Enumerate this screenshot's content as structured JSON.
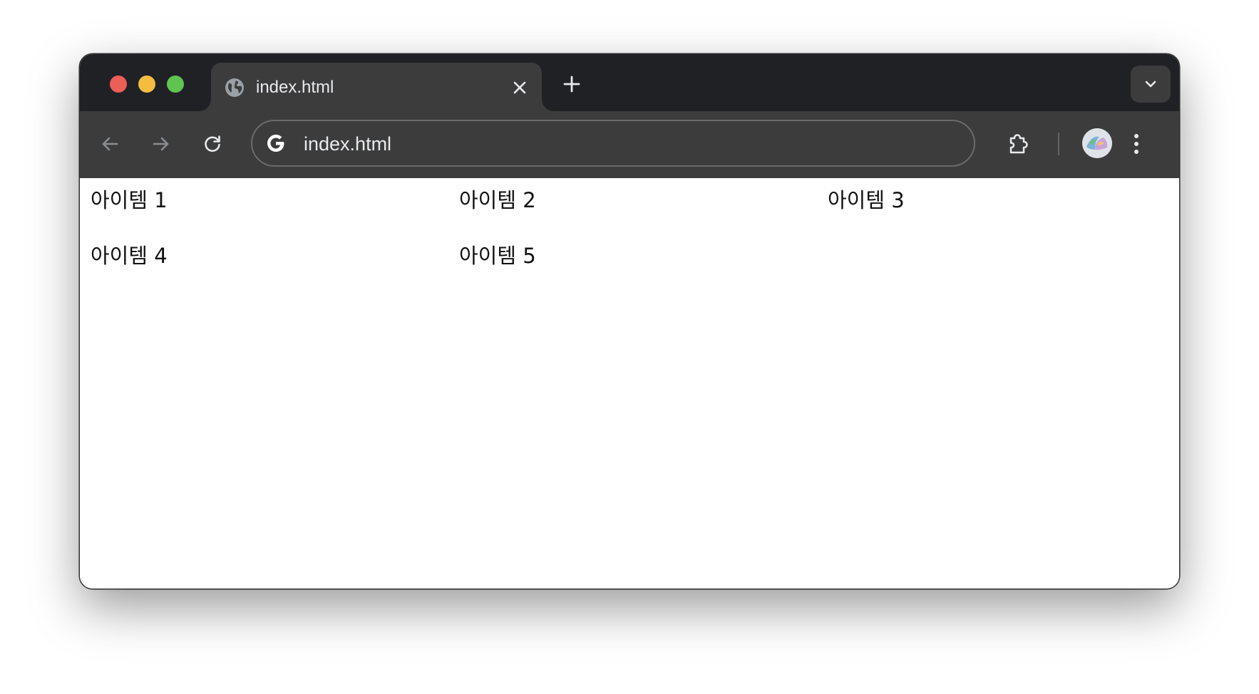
{
  "window": {
    "traffic_lights": {
      "close_color": "#ec5f57",
      "minimize_color": "#f4bd41",
      "maximize_color": "#5fc451"
    }
  },
  "tabs": [
    {
      "title": "index.html",
      "favicon": "globe-icon",
      "active": true
    }
  ],
  "toolbar": {
    "back_icon": "arrow-left-icon",
    "forward_icon": "arrow-right-icon",
    "reload_icon": "reload-icon",
    "extensions_icon": "puzzle-icon",
    "menu_icon": "kebab-menu-icon"
  },
  "omnibox": {
    "url": "index.html",
    "icon": "google-icon"
  },
  "page": {
    "items": [
      "아이템 1",
      "아이템 2",
      "아이템 3",
      "아이템 4",
      "아이템 5"
    ]
  }
}
